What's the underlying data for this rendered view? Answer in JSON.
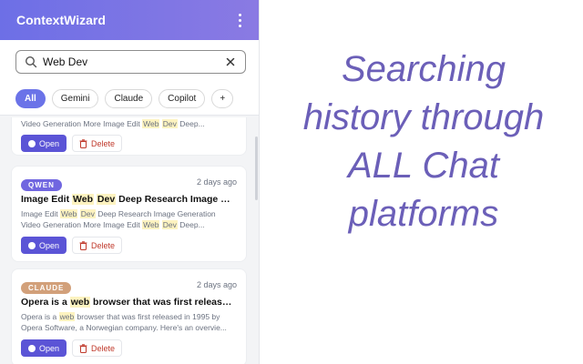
{
  "app": {
    "name": "ContextWizard"
  },
  "search": {
    "value": "Web Dev"
  },
  "filters": [
    "All",
    "Gemini",
    "Claude",
    "Copilot",
    "+"
  ],
  "cards": [
    {
      "snippet_tail": [
        "Video Generation More Image Edit ",
        "Web",
        " ",
        "Dev",
        " Deep..."
      ],
      "open_label": "Open",
      "delete_label": "Delete"
    },
    {
      "platform": "QWEN",
      "age": "2 days ago",
      "title": [
        "Image Edit ",
        "Web",
        " ",
        "Dev",
        " Deep Research Image Gen..."
      ],
      "snippet": [
        "Image Edit ",
        "Web",
        " ",
        "Dev",
        " Deep Research Image Generation",
        "Video Generation More Image Edit ",
        "Web",
        " ",
        "Dev",
        " Deep..."
      ],
      "open_label": "Open",
      "delete_label": "Delete"
    },
    {
      "platform": "CLAUDE",
      "age": "2 days ago",
      "title": [
        "Opera is a ",
        "web",
        " browser that was first released i..."
      ],
      "snippet": [
        "Opera is a ",
        "web",
        " browser that was first released in 1995 by",
        "Opera Software, a Norwegian company. Here's an overvie..."
      ],
      "open_label": "Open",
      "delete_label": "Delete"
    }
  ],
  "promo": {
    "lines": [
      "Searching",
      "history through",
      "ALL Chat",
      "platforms"
    ]
  },
  "colors": {
    "accent": "#5b54d6",
    "header_start": "#6d6fe6",
    "header_end": "#8a7ae3",
    "promo": "#6b5fb8",
    "highlight": "#fdf3c0"
  }
}
